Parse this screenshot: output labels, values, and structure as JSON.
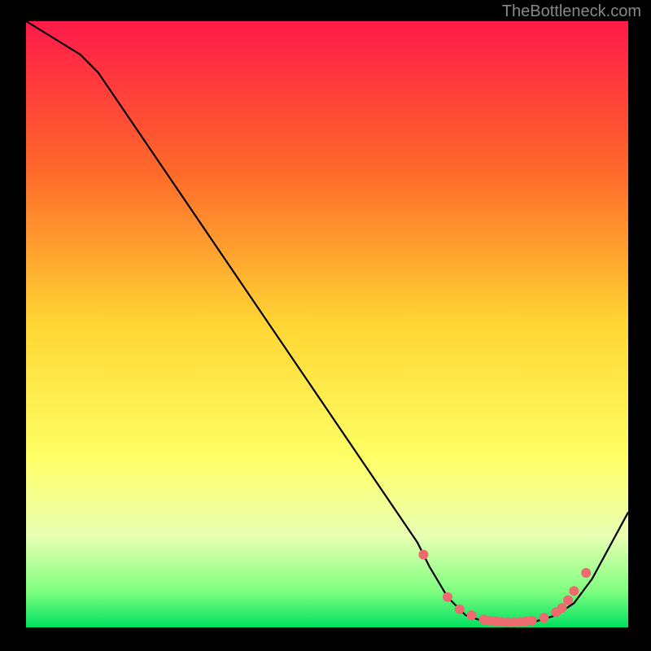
{
  "attribution": "TheBottleneck.com",
  "chart_data": {
    "type": "line",
    "title": "",
    "xlabel": "",
    "ylabel": "",
    "xlim": [
      0,
      100
    ],
    "ylim": [
      0,
      100
    ],
    "gradient_stops": [
      {
        "offset": 0,
        "color": "#ff1a4a"
      },
      {
        "offset": 25,
        "color": "#ff6a2a"
      },
      {
        "offset": 50,
        "color": "#ffd633"
      },
      {
        "offset": 72,
        "color": "#ffff66"
      },
      {
        "offset": 85,
        "color": "#e8ffb3"
      },
      {
        "offset": 94,
        "color": "#80ff80"
      },
      {
        "offset": 100,
        "color": "#00e060"
      }
    ],
    "curve": [
      {
        "x": 0,
        "y": 100
      },
      {
        "x": 9,
        "y": 94.5
      },
      {
        "x": 12,
        "y": 91.5
      },
      {
        "x": 65,
        "y": 14
      },
      {
        "x": 67,
        "y": 10
      },
      {
        "x": 70,
        "y": 5
      },
      {
        "x": 73,
        "y": 2
      },
      {
        "x": 76,
        "y": 1
      },
      {
        "x": 80,
        "y": 0.5
      },
      {
        "x": 84,
        "y": 0.8
      },
      {
        "x": 88,
        "y": 2
      },
      {
        "x": 91,
        "y": 4
      },
      {
        "x": 94,
        "y": 8
      },
      {
        "x": 100,
        "y": 19
      }
    ],
    "markers": [
      {
        "x": 66,
        "y": 12
      },
      {
        "x": 70,
        "y": 5
      },
      {
        "x": 72,
        "y": 3
      },
      {
        "x": 74,
        "y": 2
      },
      {
        "x": 76,
        "y": 1.3
      },
      {
        "x": 77,
        "y": 1.1
      },
      {
        "x": 78,
        "y": 1
      },
      {
        "x": 79,
        "y": 0.9
      },
      {
        "x": 80,
        "y": 0.85
      },
      {
        "x": 81,
        "y": 0.85
      },
      {
        "x": 82,
        "y": 0.9
      },
      {
        "x": 83,
        "y": 1
      },
      {
        "x": 84,
        "y": 1.1
      },
      {
        "x": 86,
        "y": 1.6
      },
      {
        "x": 88,
        "y": 2.5
      },
      {
        "x": 89,
        "y": 3.2
      },
      {
        "x": 90,
        "y": 4.5
      },
      {
        "x": 91,
        "y": 6
      },
      {
        "x": 93,
        "y": 9
      }
    ],
    "marker_color": "#ed6b6e",
    "marker_radius": 6
  }
}
